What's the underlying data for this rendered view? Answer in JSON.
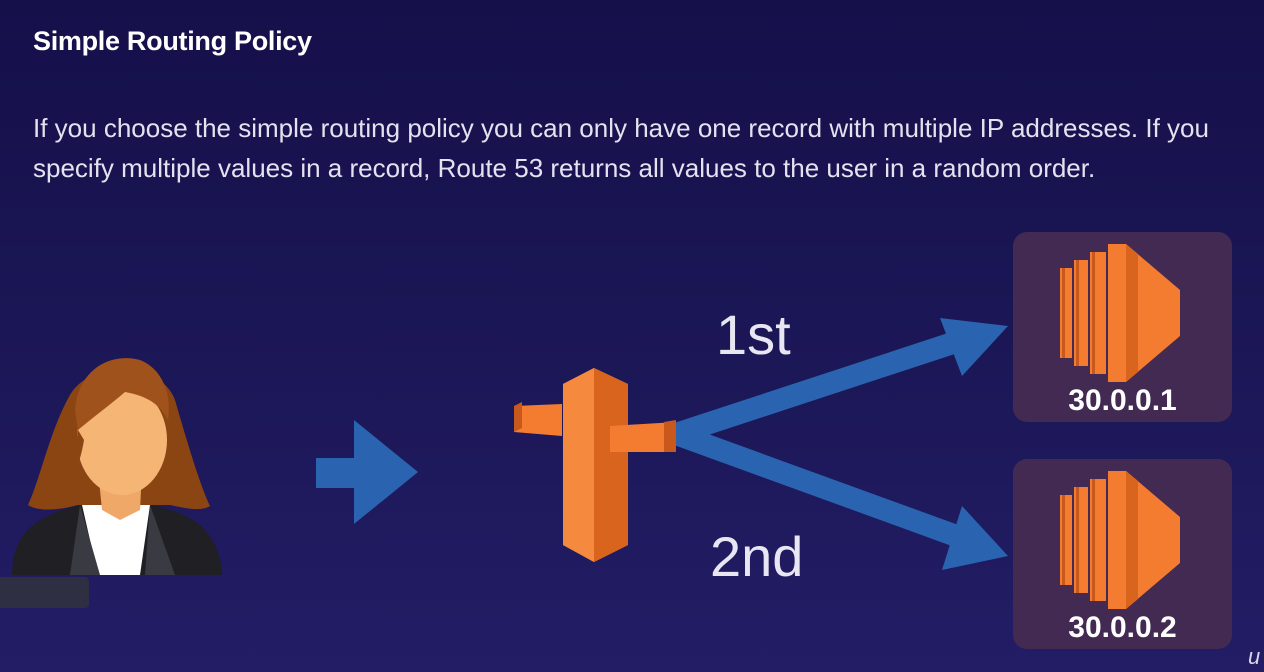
{
  "slide": {
    "title": "Simple Routing Policy",
    "description": "If you choose the simple routing policy you can only have one record with multiple IP addresses. If you specify multiple values in a record, Route 53 returns all values to the user in a random order."
  },
  "diagram": {
    "first_label": "1st",
    "second_label": "2nd",
    "servers": [
      {
        "ip": "30.0.0.1"
      },
      {
        "ip": "30.0.0.2"
      }
    ],
    "icons": {
      "user": "user-icon",
      "route53": "route53-signpost-icon",
      "server": "ec2-instance-icon"
    },
    "colors": {
      "arrow": "#2a64b0",
      "aws_orange": "#f47c31",
      "server_panel": "#432a52"
    }
  },
  "watermark": "u"
}
